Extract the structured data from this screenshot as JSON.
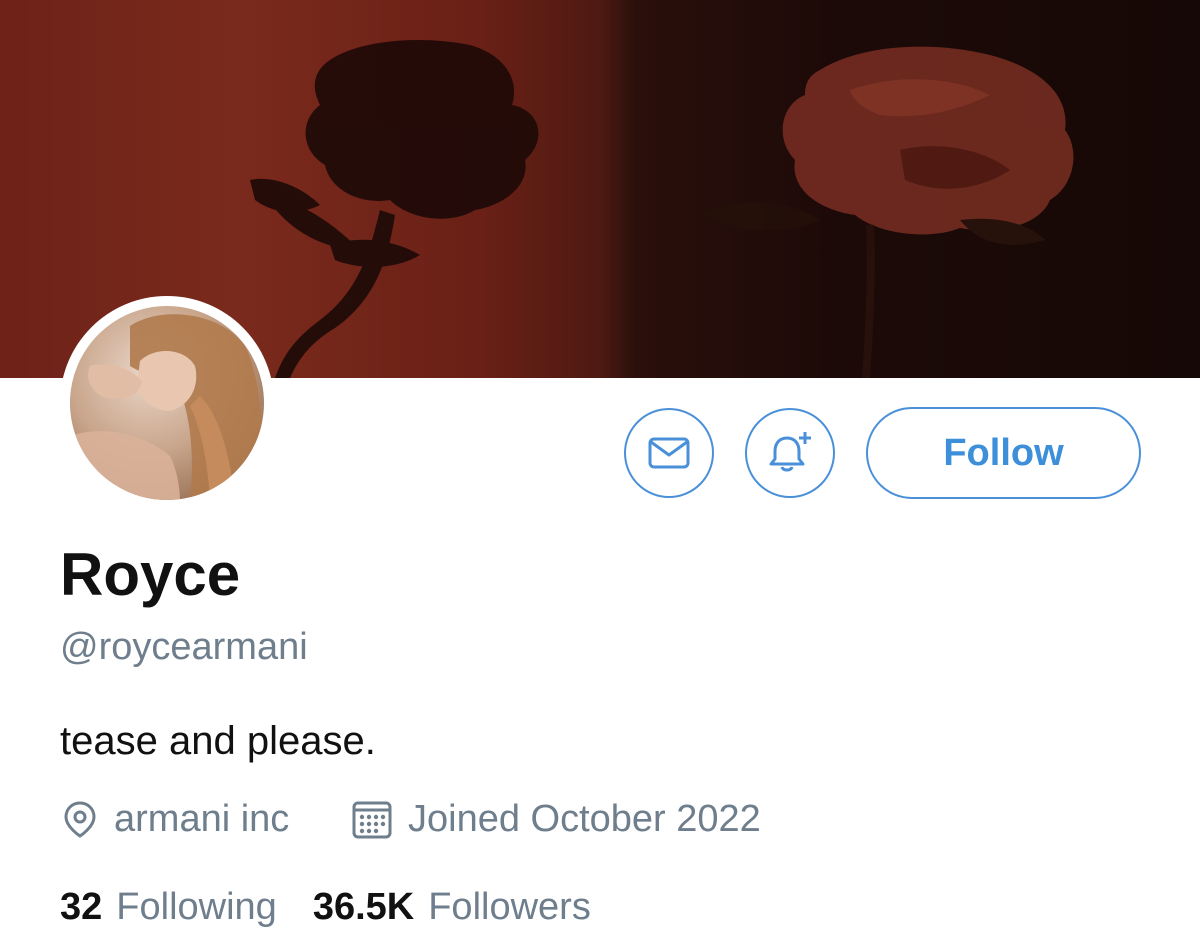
{
  "profile": {
    "display_name": "Royce",
    "handle": "@roycearmani",
    "bio": "tease and please.",
    "location": "armani inc",
    "joined": "Joined October 2022"
  },
  "actions": {
    "message_icon": "envelope-icon",
    "notify_icon": "bell-plus-icon",
    "follow_label": "Follow"
  },
  "stats": {
    "following_count": "32",
    "following_label": "Following",
    "followers_count": "36.5K",
    "followers_label": "Followers"
  },
  "colors": {
    "accent": "#3d8fd9",
    "secondary_text": "#6e7e8c",
    "primary_text": "#111111"
  }
}
